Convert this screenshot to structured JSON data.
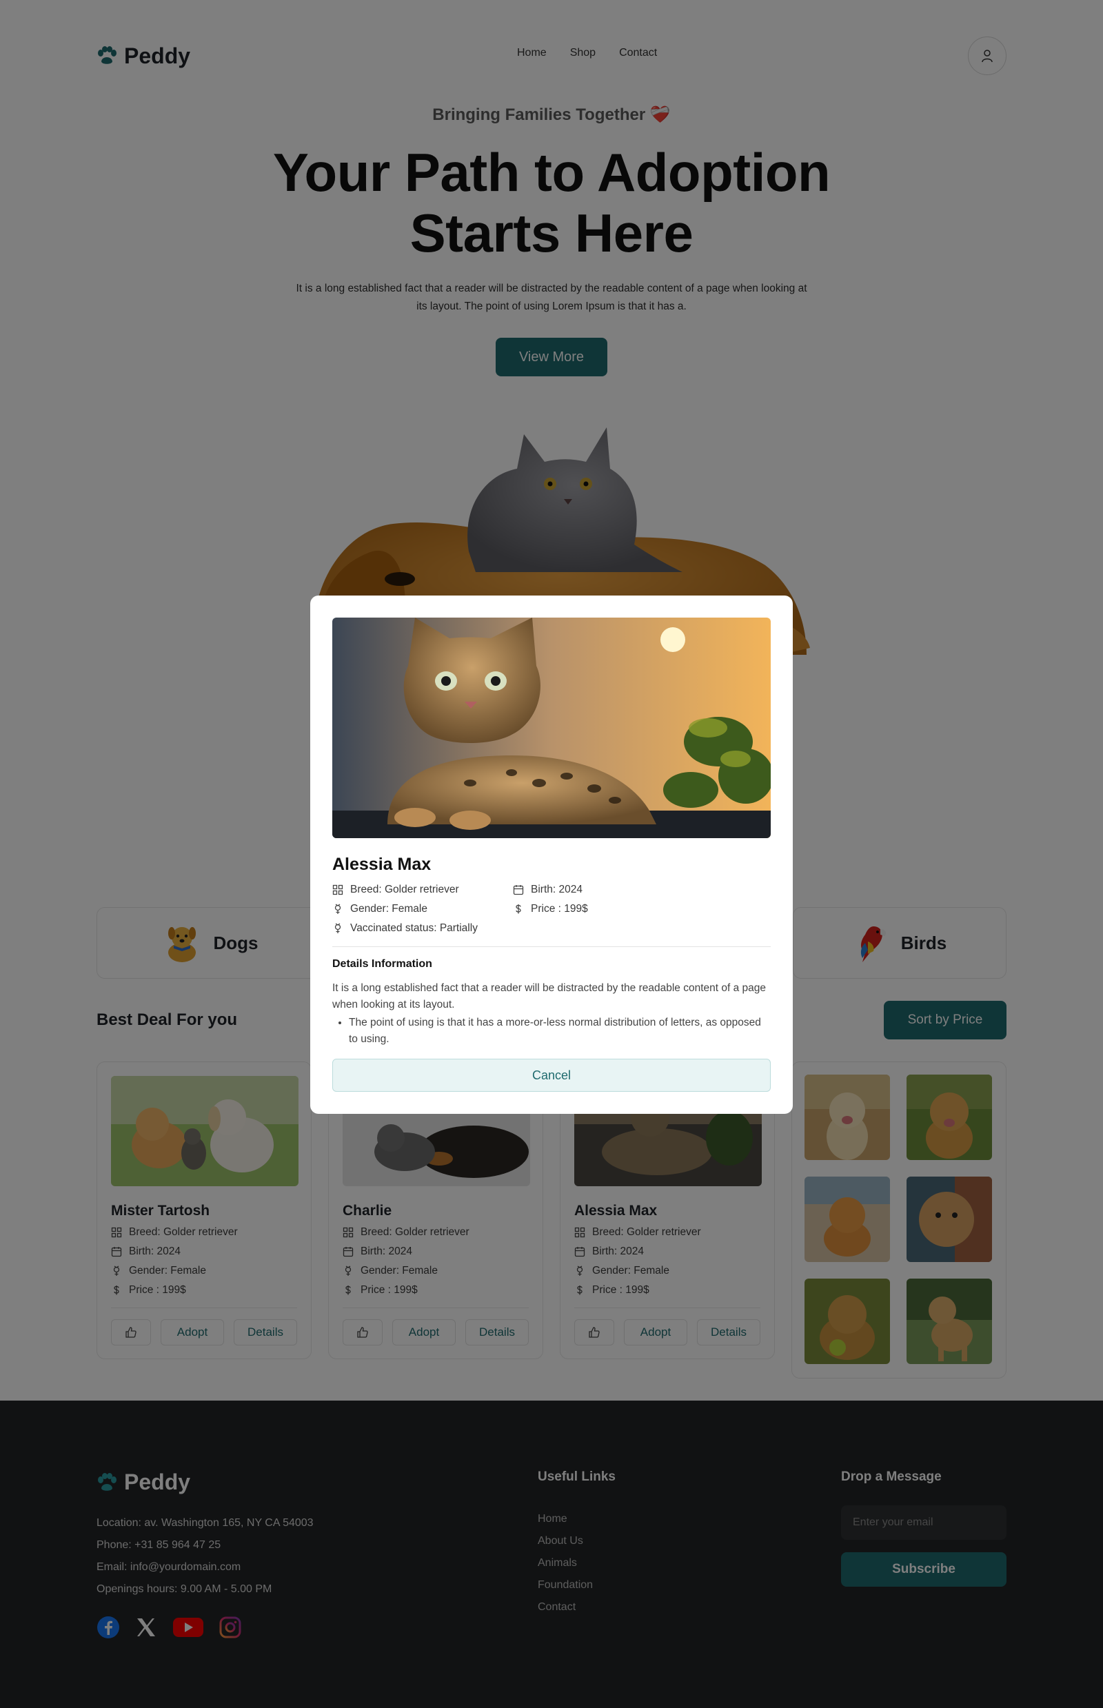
{
  "header": {
    "logo_text": "Peddy",
    "nav": [
      "Home",
      "Shop",
      "Contact"
    ],
    "user_icon": "user-icon"
  },
  "hero": {
    "tagline": "Bringing Families Together ❤️‍🩹",
    "title": "Your Path to Adoption Starts Here",
    "description": "It is a long established fact that a reader will be distracted by the readable content of a page when looking at its layout. The point of using Lorem Ipsum is that it has a.",
    "cta_label": "View More"
  },
  "categories": [
    {
      "label": "Dogs",
      "icon": "dog-icon"
    },
    {
      "label": "Birds",
      "icon": "parrot-icon"
    }
  ],
  "deals": {
    "title": "Best Deal For you",
    "sort_label": "Sort by Price",
    "cards": [
      {
        "name": "Mister Tartosh",
        "breed": "Breed: Golder retriever",
        "birth": "Birth: 2024",
        "gender": "Gender: Female",
        "price": "Price : 199$",
        "adopt": "Adopt",
        "details": "Details"
      },
      {
        "name": "Charlie",
        "breed": "Breed: Golder retriever",
        "birth": "Birth: 2024",
        "gender": "Gender: Female",
        "price": "Price : 199$",
        "adopt": "Adopt",
        "details": "Details"
      },
      {
        "name": "Alessia Max",
        "breed": "Breed: Golder retriever",
        "birth": "Birth: 2024",
        "gender": "Gender: Female",
        "price": "Price : 199$",
        "adopt": "Adopt",
        "details": "Details"
      }
    ]
  },
  "modal": {
    "name": "Alessia Max",
    "breed": "Breed: Golder retriever",
    "gender": "Gender: Female",
    "vaccinated": "Vaccinated status: Partially",
    "birth": "Birth: 2024",
    "price": "Price : 199$",
    "details_title": "Details Information",
    "details_text": "It is a long established fact that a reader will be distracted by the readable content of a page when looking at its layout.",
    "details_bullet": "The point of using is that it has a more-or-less normal distribution of letters, as opposed to using.",
    "cancel_label": "Cancel"
  },
  "footer": {
    "logo_text": "Peddy",
    "location": "Location: av. Washington 165, NY CA 54003",
    "phone": "Phone: +31 85 964 47 25",
    "email": "Email: info@yourdomain.com",
    "hours": "Openings hours: 9.00 AM - 5.00 PM",
    "social": [
      "facebook-icon",
      "x-icon",
      "youtube-icon",
      "instagram-icon"
    ],
    "links_title": "Useful Links",
    "links": [
      "Home",
      "About Us",
      "Animals",
      "Foundation",
      "Contact"
    ],
    "message_title": "Drop a Message",
    "email_placeholder": "Enter your email",
    "subscribe_label": "Subscribe"
  },
  "colors": {
    "accent": "#1f6b6e",
    "footer_bg": "#222426",
    "overlay": "rgba(0,0,0,0.5)"
  }
}
